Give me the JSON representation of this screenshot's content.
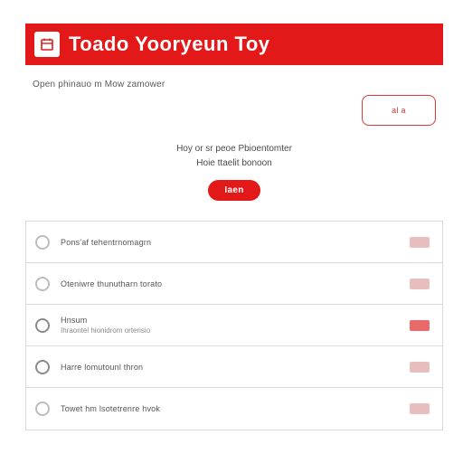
{
  "header": {
    "icon": "calendar-icon",
    "title": "Toado Yooryeun Toy"
  },
  "intro": {
    "subhead": "Open phinauo m Mow zamower"
  },
  "cta": {
    "label": "al a"
  },
  "promo": {
    "line1": "Hoy or sr peoe Pbioentomter",
    "line2": "Hoie ttaelit bonoon",
    "button": "Iaen"
  },
  "rows": [
    {
      "title": "Pons'af tehentrnomagrn",
      "sub": "",
      "radio": "open",
      "action": "light"
    },
    {
      "title": "Oteniwre thunutharn torato",
      "sub": "",
      "radio": "open",
      "action": "light"
    },
    {
      "title": "Hnsum",
      "sub": "Ihraontel hionidrom orterisio",
      "radio": "filled",
      "action": "solid"
    },
    {
      "title": "Harre lomutounl thron",
      "sub": "",
      "radio": "filled",
      "action": "light"
    },
    {
      "title": "Towet hm lsotetrenre hvok",
      "sub": "",
      "radio": "open",
      "action": "light"
    }
  ]
}
